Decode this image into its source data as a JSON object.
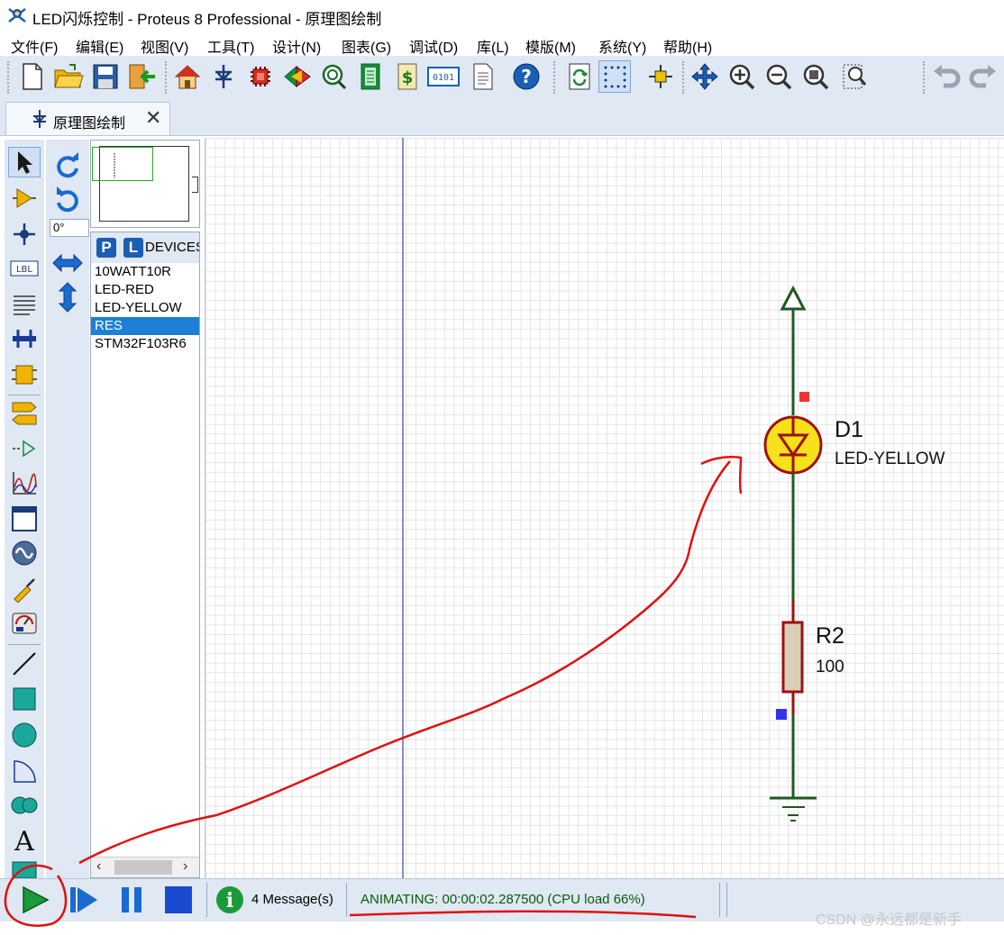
{
  "window": {
    "title": "LED闪烁控制 - Proteus 8 Professional - 原理图绘制"
  },
  "menu": {
    "items": [
      "文件(F)",
      "编辑(E)",
      "视图(V)",
      "工具(T)",
      "设计(N)",
      "图表(G)",
      "调试(D)",
      "库(L)",
      "模版(M)",
      "系统(Y)",
      "帮助(H)"
    ]
  },
  "toolbar": {
    "icons": [
      "new-file-icon",
      "open-folder-icon",
      "save-icon",
      "import-icon",
      "home-icon",
      "schematic-icon",
      "pcb-icon",
      "3d-view-icon",
      "gerber-icon",
      "bom-icon",
      "design-explorer-icon",
      "binary-icon",
      "notes-icon",
      "help-icon",
      "refresh-icon",
      "grid-icon",
      "origin-icon",
      "pan-icon",
      "zoom-in-icon",
      "zoom-out-icon",
      "zoom-all-icon",
      "zoom-area-icon",
      "undo-icon",
      "redo-icon"
    ]
  },
  "tab": {
    "label": "原理图绘制",
    "close": "✕"
  },
  "rotation": {
    "angle": "0°"
  },
  "devices": {
    "p_label": "P",
    "l_label": "L",
    "header": "DEVICES",
    "items": [
      "10WATT10R",
      "LED-RED",
      "LED-YELLOW",
      "RES",
      "STM32F103R6"
    ],
    "selected": "RES"
  },
  "schematic": {
    "d1_ref": "D1",
    "d1_value": "LED-YELLOW",
    "r2_ref": "R2",
    "r2_value": "100",
    "led_color": "#f5e21a",
    "wire_color": "#1f5a1f",
    "part_outline": "#a01010"
  },
  "status": {
    "messages": "4 Message(s)",
    "animating": "ANIMATING: 00:00:02.287500 (CPU load 66%)",
    "info_icon": "i"
  },
  "watermark": "CSDN @永远都是新手",
  "annotation_color": "#e01010"
}
